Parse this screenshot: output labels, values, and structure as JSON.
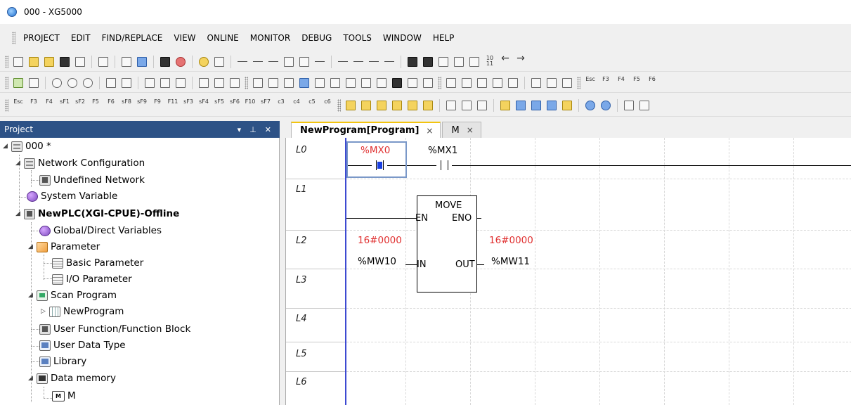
{
  "window": {
    "title": "000 - XG5000"
  },
  "menu": [
    "PROJECT",
    "EDIT",
    "FIND/REPLACE",
    "VIEW",
    "ONLINE",
    "MONITOR",
    "DEBUG",
    "TOOLS",
    "WINDOW",
    "HELP"
  ],
  "project_panel": {
    "title": "Project",
    "pin_icon": "pin-icon",
    "close_icon": "close-icon",
    "tree": [
      {
        "label": "000 *",
        "level": 0,
        "icon": "project-icon",
        "expanded": true,
        "bold": false
      },
      {
        "label": "Network Configuration",
        "level": 1,
        "icon": "network-icon",
        "expanded": true,
        "bold": false
      },
      {
        "label": "Undefined Network",
        "level": 2,
        "icon": "undefined-network-icon",
        "expanded": null,
        "bold": false
      },
      {
        "label": "System Variable",
        "level": 1,
        "icon": "system-variable-icon",
        "expanded": null,
        "bold": false
      },
      {
        "label": "NewPLC(XGI-CPUE)-Offline",
        "level": 1,
        "icon": "plc-icon",
        "expanded": true,
        "bold": true
      },
      {
        "label": "Global/Direct Variables",
        "level": 2,
        "icon": "global-variables-icon",
        "expanded": null,
        "bold": false
      },
      {
        "label": "Parameter",
        "level": 2,
        "icon": "parameter-icon",
        "expanded": true,
        "bold": false
      },
      {
        "label": "Basic Parameter",
        "level": 3,
        "icon": "basic-parameter-icon",
        "expanded": null,
        "bold": false
      },
      {
        "label": "I/O Parameter",
        "level": 3,
        "icon": "io-parameter-icon",
        "expanded": null,
        "bold": false
      },
      {
        "label": "Scan Program",
        "level": 2,
        "icon": "scan-program-icon",
        "expanded": true,
        "bold": false
      },
      {
        "label": "NewProgram",
        "level": 3,
        "icon": "program-icon",
        "expanded": false,
        "bold": false
      },
      {
        "label": "User Function/Function Block",
        "level": 2,
        "icon": "user-function-icon",
        "expanded": null,
        "bold": false
      },
      {
        "label": "User Data Type",
        "level": 2,
        "icon": "user-data-type-icon",
        "expanded": null,
        "bold": false
      },
      {
        "label": "Library",
        "level": 2,
        "icon": "library-icon",
        "expanded": null,
        "bold": false
      },
      {
        "label": "Data memory",
        "level": 2,
        "icon": "data-memory-icon",
        "expanded": true,
        "bold": false
      },
      {
        "label": "M",
        "level": 3,
        "icon": "m-memory-icon",
        "expanded": null,
        "bold": false
      }
    ]
  },
  "tabs": [
    {
      "label": "NewProgram[Program]",
      "active": true,
      "close": "×"
    },
    {
      "label": "M",
      "active": false,
      "close": "×"
    }
  ],
  "ladder": {
    "line_labels": [
      "L0",
      "L1",
      "L2",
      "L3",
      "L4",
      "L5",
      "L6"
    ],
    "contact1": "%MX0",
    "contact2": "%MX1",
    "fb_name": "MOVE",
    "fb_en": "EN",
    "fb_eno": "ENO",
    "fb_in": "IN",
    "fb_out": "OUT",
    "in_value": "16#0000",
    "in_var": "%MW10",
    "out_value": "16#0000",
    "out_var": "%MW11"
  },
  "toolbar_key_labels": {
    "row3": [
      "Esc",
      "F3",
      "F4",
      "sF1",
      "sF2",
      "F5",
      "F6",
      "sF8",
      "sF9",
      "F9",
      "F11",
      "sF3",
      "sF4",
      "sF5",
      "sF6",
      "F10",
      "sF7",
      "c3",
      "c4",
      "c5",
      "c6"
    ],
    "row2_right": [
      "Esc",
      "F3",
      "F4",
      "F5",
      "F6"
    ]
  },
  "colors": {
    "accent": "#2d5286",
    "rail": "#3d4ad1",
    "value_red": "#e03030",
    "selection": "#7a98c8"
  }
}
